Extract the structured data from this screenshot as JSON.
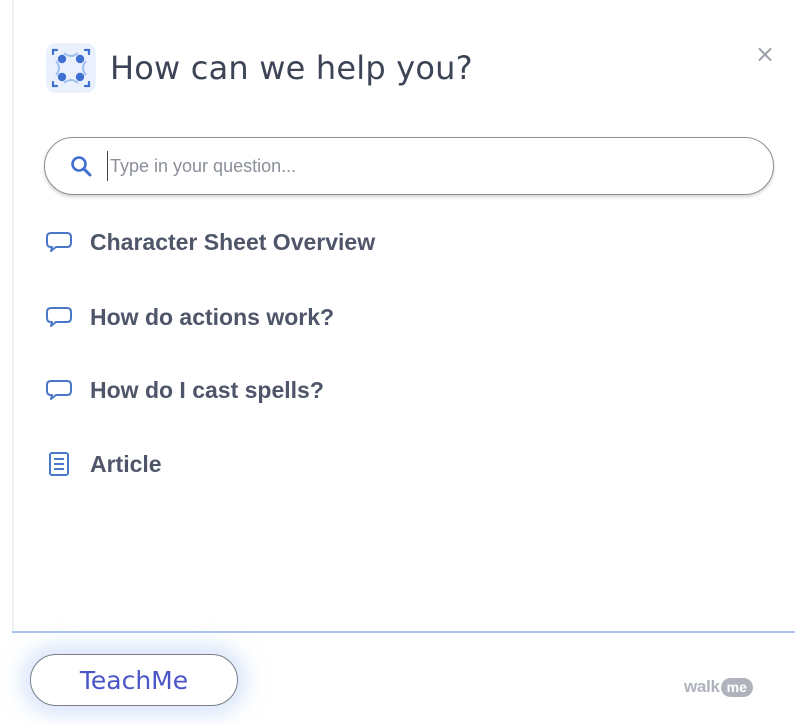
{
  "header": {
    "title": "How can we help you?",
    "logo_icon": "walkme-logo-icon",
    "close_label": "×"
  },
  "search": {
    "placeholder": "Type in your question...",
    "value": ""
  },
  "items": [
    {
      "label": "Character Sheet Overview",
      "icon": "chat-bubble-icon"
    },
    {
      "label": "How do actions work?",
      "icon": "chat-bubble-icon"
    },
    {
      "label": "How do I cast spells?",
      "icon": "chat-bubble-icon"
    },
    {
      "label": "Article",
      "icon": "article-icon"
    }
  ],
  "footer": {
    "teachme_label": "TeachMe",
    "brand_text": "walk",
    "brand_badge": "me"
  },
  "colors": {
    "accent": "#4a56c8",
    "icon_blue": "#4a78c8",
    "title": "#3d4456",
    "item_text": "#4f566a",
    "footer_line": "#a9c4ee",
    "brand_gray": "#aeb3bc"
  }
}
